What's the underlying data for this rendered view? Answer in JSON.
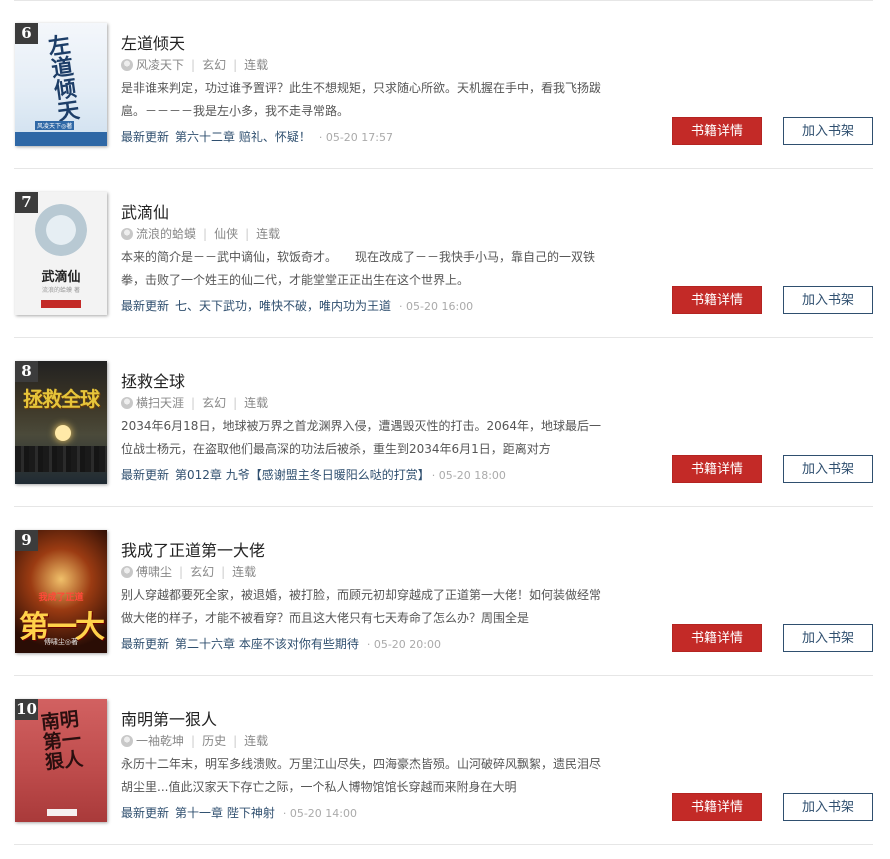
{
  "labels": {
    "latest_update": "最新更新",
    "book_detail": "书籍详情",
    "add_to_shelf": "加入书架",
    "separator": "|"
  },
  "books": [
    {
      "rank": "6",
      "title": "左道倾天",
      "author": "风凌天下",
      "genre": "玄幻",
      "status": "连载",
      "description": "是非谁来判定，功过谁予置评？此生不想规矩，只求随心所欲。天机握在手中，看我飞扬跋扈。－－－－我是左小多，我不走寻常路。",
      "latest_chapter": "第六十二章 赔礼、怀疑！",
      "update_time": "· 05-20 17:57",
      "cover_text": "左道倾天",
      "cover_subtext": "风凌天下◎著"
    },
    {
      "rank": "7",
      "title": "武滴仙",
      "author": "流浪的蛤蟆",
      "genre": "仙侠",
      "status": "连载",
      "description": "本来的简介是－－武中谪仙，软饭奇才。　　现在改成了－－我快手小马，靠自己的一双铁拳，击败了一个姓王的仙二代，才能堂堂正正出生在这个世界上。",
      "latest_chapter": "七、天下武功，唯快不破，唯内功为王道",
      "update_time": "· 05-20 16:00",
      "cover_text": "武滴仙",
      "cover_subtext": "流浪的蛤蟆 著"
    },
    {
      "rank": "8",
      "title": "拯救全球",
      "author": "横扫天涯",
      "genre": "玄幻",
      "status": "连载",
      "description": "2034年6月18日，地球被万界之首龙渊界入侵，遭遇毁灭性的打击。2064年，地球最后一位战士杨元，在盗取他们最高深的功法后被杀，重生到2034年6月1日，距离对方",
      "latest_chapter": "第012章 九爷【感谢盟主冬日暖阳么哒的打赏】",
      "update_time": "· 05-20 18:00",
      "cover_text": "拯救全球"
    },
    {
      "rank": "9",
      "title": "我成了正道第一大佬",
      "author": "傅啸尘",
      "genre": "玄幻",
      "status": "连载",
      "description": "别人穿越都要死全家，被退婚，被打脸，而顾元初却穿越成了正道第一大佬！如何装做经常做大佬的样子，才能不被看穿？而且这大佬只有七天寿命了怎么办？周围全是",
      "latest_chapter": "第二十六章 本座不该对你有些期待",
      "update_time": "· 05-20 20:00",
      "cover_text_top": "我成了正道",
      "cover_text_main": "第一大佬",
      "cover_subtext": "傅啸尘◎著"
    },
    {
      "rank": "10",
      "title": "南明第一狠人",
      "author": "一袖乾坤",
      "genre": "历史",
      "status": "连载",
      "description": "永历十二年末，明军多线溃败。万里江山尽失，四海豪杰皆殒。山河破碎风飘絮，遗民泪尽胡尘里...值此汉家天下存亡之际，一个私人博物馆馆长穿越而来附身在大明",
      "latest_chapter": "第十一章 陛下神射",
      "update_time": "· 05-20 14:00",
      "cover_text": "南明第一狠人"
    }
  ]
}
